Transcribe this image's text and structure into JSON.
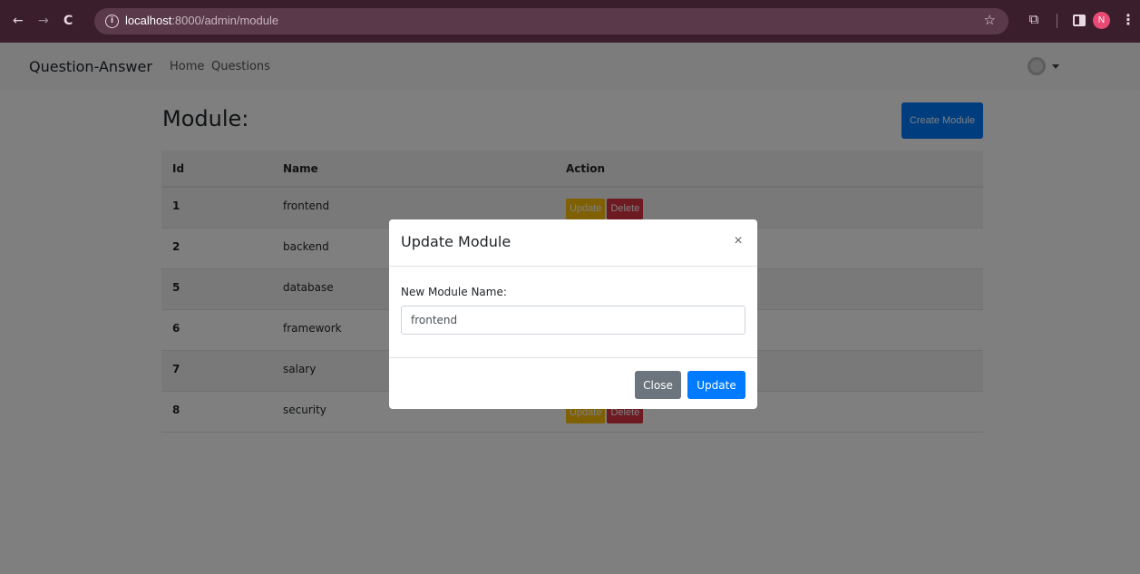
{
  "browser": {
    "url_host": "localhost",
    "url_path": ":8000/admin/module",
    "profile_initial": "N"
  },
  "navbar": {
    "brand": "Question-Answer",
    "links": [
      "Home",
      "Questions"
    ]
  },
  "main": {
    "title": "Module:",
    "create_label": "Create Module",
    "table": {
      "headers": [
        "Id",
        "Name",
        "Action"
      ],
      "rows": [
        {
          "id": "1",
          "name": "frontend"
        },
        {
          "id": "2",
          "name": "backend"
        },
        {
          "id": "5",
          "name": "database"
        },
        {
          "id": "6",
          "name": "framework"
        },
        {
          "id": "7",
          "name": "salary"
        },
        {
          "id": "8",
          "name": "security"
        }
      ],
      "update_label": "Update",
      "delete_label": "Delete"
    }
  },
  "modal": {
    "title": "Update Module",
    "close_glyph": "×",
    "label": "New Module Name:",
    "input_value": "frontend",
    "close_label": "Close",
    "update_label": "Update"
  },
  "colors": {
    "primary": "#007bff",
    "warning": "#ffc107",
    "danger": "#dc3545",
    "secondary": "#6c757d",
    "chrome": "#3a1e2c"
  }
}
